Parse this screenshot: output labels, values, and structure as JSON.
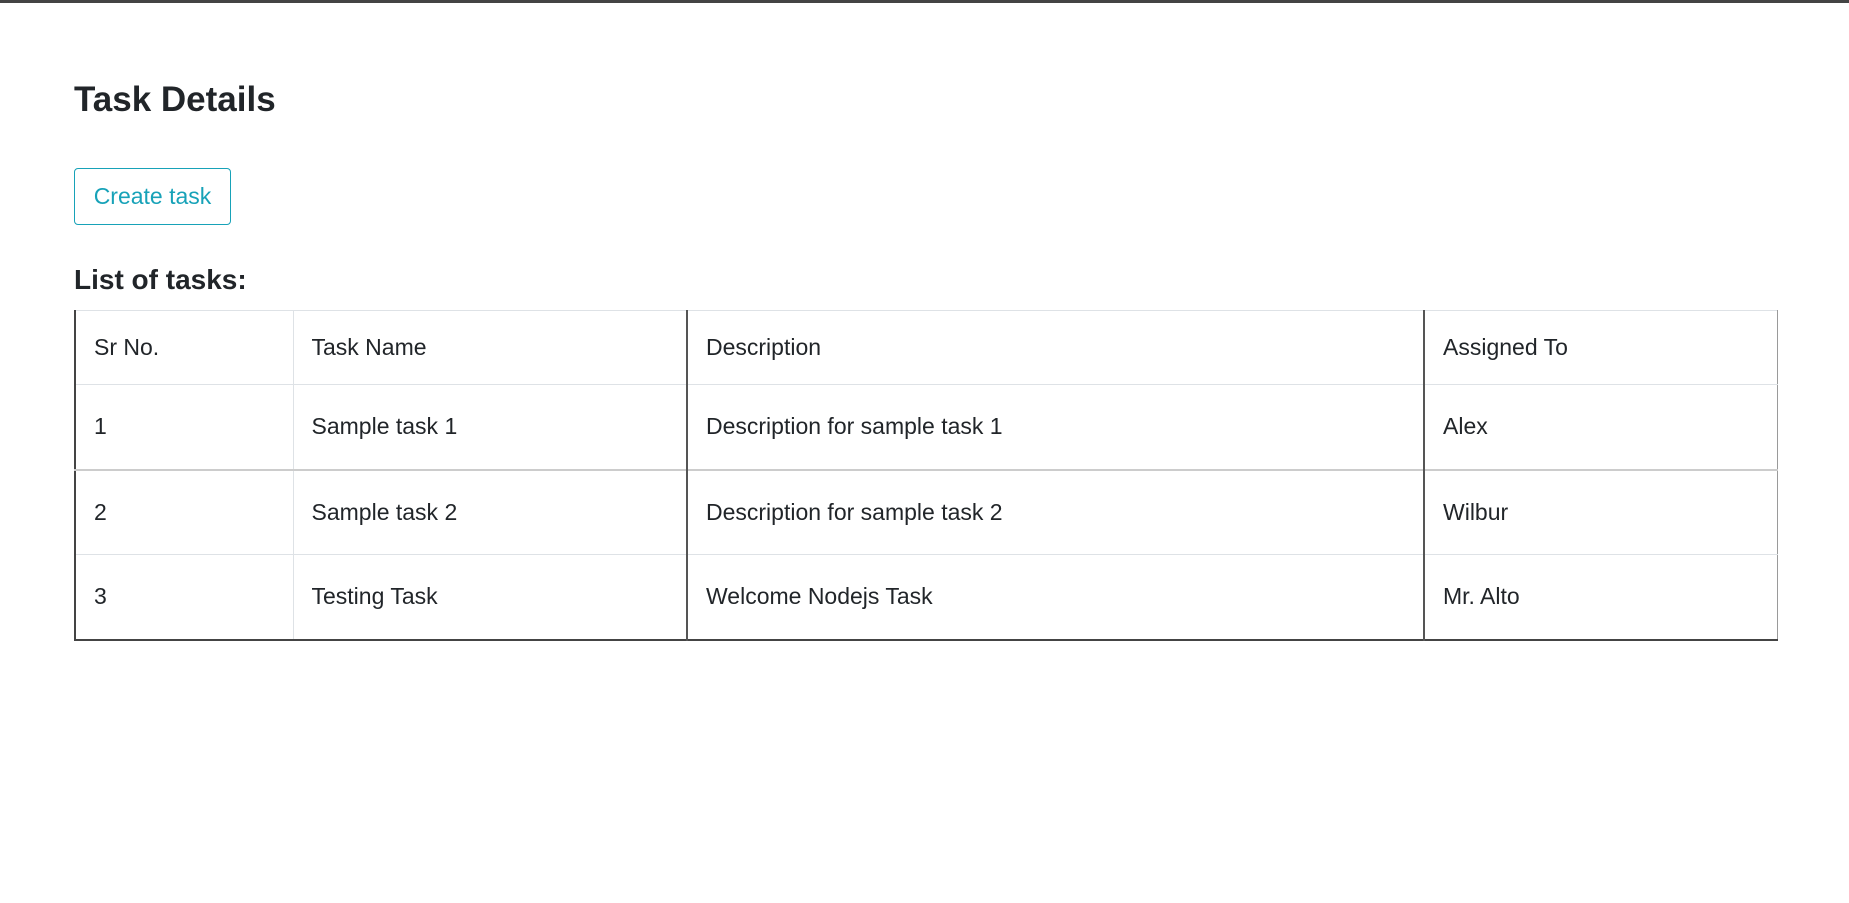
{
  "page": {
    "title": "Task Details",
    "create_button_label": "Create task",
    "list_title": "List of tasks:"
  },
  "colors": {
    "accent": "#17a2b8",
    "text": "#212529"
  },
  "table": {
    "headers": {
      "sr_no": "Sr No.",
      "task_name": "Task Name",
      "description": "Description",
      "assigned_to": "Assigned To"
    },
    "rows": [
      {
        "sr_no": "1",
        "task_name": "Sample task 1",
        "description": "Description for sample task 1",
        "assigned_to": "Alex"
      },
      {
        "sr_no": "2",
        "task_name": "Sample task 2",
        "description": "Description for sample task 2",
        "assigned_to": "Wilbur"
      },
      {
        "sr_no": "3",
        "task_name": "Testing Task",
        "description": "Welcome Nodejs Task",
        "assigned_to": "Mr. Alto"
      }
    ]
  }
}
